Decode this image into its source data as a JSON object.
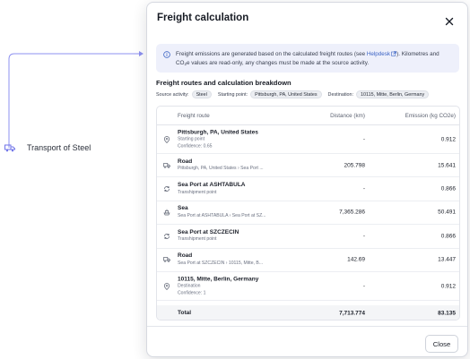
{
  "background": {
    "node_label": "Transport of Steel",
    "node_icon": "truck-icon"
  },
  "modal": {
    "title": "Freight calculation",
    "close_icon": "close-icon",
    "info": {
      "text_before_link": "Freight emissions are generated based on the calculated freight routes (see ",
      "link": "Helpdesk",
      "text_after_link": "). Kilometres and CO",
      "co2_sub": "2",
      "text_end": "e values are read-only, any changes must be made at the source activity."
    },
    "section_title": "Freight routes and calculation breakdown",
    "meta": {
      "source_label": "Source activity:",
      "source_value": "Steel",
      "start_label": "Starting point:",
      "start_value": "Pittsburgh, PA, United States",
      "dest_label": "Destination:",
      "dest_value": "10115, Mitte, Berlin, Germany"
    },
    "table": {
      "columns": [
        "Freight route",
        "Distance (km)",
        "Emission (kg CO2e)"
      ],
      "rows": [
        {
          "icon": "location-pin-icon",
          "name": "Pittsburgh, PA, United States",
          "sub1": "Starting point",
          "sub2": "Confidence: 0.65",
          "distance": "-",
          "emission": "0.912"
        },
        {
          "icon": "truck-icon",
          "name": "Road",
          "sub1": "Pittsburgh, PA, United States › Sea Port ...",
          "distance": "205.798",
          "emission": "15.641"
        },
        {
          "icon": "transship-icon",
          "name": "Sea Port at ASHTABULA",
          "sub1": "Transhipment point",
          "distance": "-",
          "emission": "0.866"
        },
        {
          "icon": "ship-icon",
          "name": "Sea",
          "sub1": "Sea Port at ASHTABULA › Sea Port at SZ...",
          "distance": "7,365.286",
          "emission": "50.491"
        },
        {
          "icon": "transship-icon",
          "name": "Sea Port at SZCZECIN",
          "sub1": "Transhipment point",
          "distance": "-",
          "emission": "0.866"
        },
        {
          "icon": "truck-icon",
          "name": "Road",
          "sub1": "Sea Port at SZCZECIN › 10115, Mitte, B...",
          "distance": "142.69",
          "emission": "13.447"
        },
        {
          "icon": "location-pin-icon",
          "name": "10115, Mitte, Berlin, Germany",
          "sub1": "Destination",
          "sub2": "Confidence: 1",
          "distance": "-",
          "emission": "0.912"
        }
      ],
      "total": {
        "label": "Total",
        "distance": "7,713.774",
        "emission": "83.135"
      }
    },
    "close_button": "Close"
  },
  "colors": {
    "accent": "#3b63c4",
    "info_bg": "#eef0fb",
    "connector": "#7b7ff0"
  }
}
